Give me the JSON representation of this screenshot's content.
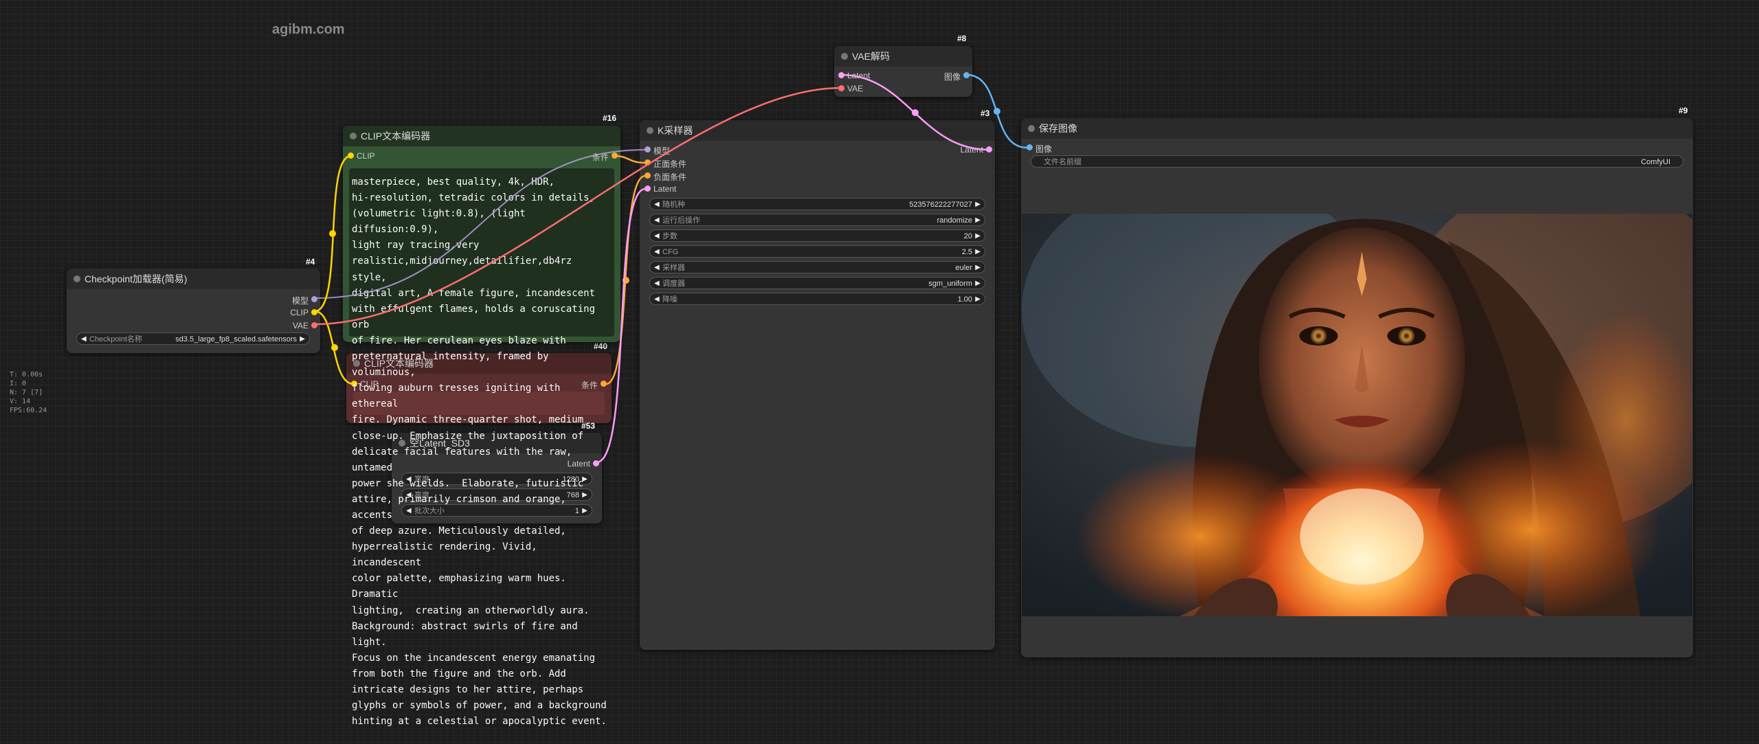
{
  "watermark": "agibm.com",
  "stats": [
    "T: 0.00s",
    "I: 0",
    "N: 7 [7]",
    "V: 14",
    "FPS:60.24"
  ],
  "colors": {
    "clip": "#ffd500",
    "model": "#b39ddb",
    "vae": "#ff6e6e",
    "latent": "#ff9cf9",
    "conditioning": "#ffa931",
    "image": "#64b5f6"
  },
  "checkpoint_node": {
    "id": "#4",
    "title": "Checkpoint加载器(简易)",
    "outputs": [
      "模型",
      "CLIP",
      "VAE"
    ],
    "widget": {
      "label": "Checkpoint名称",
      "value": "sd3.5_large_fp8_scaled.safetensors"
    }
  },
  "clip_node": {
    "id": "#16",
    "title": "CLIP文本编码器",
    "input": "CLIP",
    "output": "条件",
    "prompt": "masterpiece, best quality, 4k, HDR,\nhi-resolution, tetradic colors in details,\n(volumetric light:0.8), (light diffusion:0.9),\nlight ray tracing,very\nrealistic,midjourney,detailifier,db4rz style,\ndigital art, A female figure, incandescent\nwith effulgent flames, holds a coruscating orb\nof fire. Her cerulean eyes blaze with\npreternatural intensity, framed by voluminous,\nflowing auburn tresses igniting with ethereal\nfire. Dynamic three-quarter shot, medium\nclose-up. Emphasize the juxtaposition of\ndelicate facial features with the raw, untamed\npower she wields.  Elaborate, futuristic\nattire, primarily crimson and orange, accents\nof deep azure. Meticulously detailed,\nhyperrealistic rendering. Vivid, incandescent\ncolor palette, emphasizing warm hues. Dramatic\nlighting,  creating an otherworldly aura.\nBackground: abstract swirls of fire and light.\nFocus on the incandescent energy emanating\nfrom both the figure and the orb. Add\nintricate designs to her attire, perhaps\nglyphs or symbols of power, and a background\nhinting at a celestial or apocalyptic event."
  },
  "clip_node_2": {
    "id": "#40",
    "title": "CLIP文本编码器",
    "input": "CLIP",
    "output": "条件"
  },
  "latent_node": {
    "id": "#53",
    "title": "空Latent_SD3",
    "output": "Latent",
    "widgets": [
      {
        "label": "宽度",
        "value": "1280"
      },
      {
        "label": "高度",
        "value": "768"
      },
      {
        "label": "批次大小",
        "value": "1"
      }
    ]
  },
  "vae_node": {
    "id": "#8",
    "title": "VAE解码",
    "inputs": [
      "Latent",
      "VAE"
    ],
    "output": "图像"
  },
  "ksampler_node": {
    "id": "#3",
    "title": "K采样器",
    "inputs": [
      "模型",
      "正面条件",
      "负面条件",
      "Latent"
    ],
    "output": "Latent",
    "widgets": [
      {
        "label": "随机种",
        "value": "523576222277027"
      },
      {
        "label": "运行后操作",
        "value": "randomize"
      },
      {
        "label": "步数",
        "value": "20"
      },
      {
        "label": "CFG",
        "value": "2.5"
      },
      {
        "label": "采样器",
        "value": "euler"
      },
      {
        "label": "调度器",
        "value": "sgm_uniform"
      },
      {
        "label": "降噪",
        "value": "1.00"
      }
    ]
  },
  "save_node": {
    "id": "#9",
    "title": "保存图像",
    "input": "图像",
    "widget": {
      "label": "文件名前缀",
      "value": "ComfyUI"
    }
  }
}
